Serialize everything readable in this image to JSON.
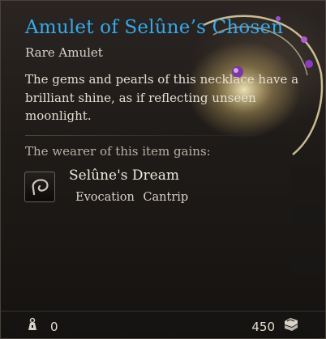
{
  "item": {
    "name": "Amulet of Selûne’s Chosen",
    "rarity_type": "Rare Amulet",
    "description": "The gems and pearls of this necklace have a brilliant shine, as if reflecting unseen moonlight.",
    "title_color": "#35a9ea"
  },
  "effects": {
    "header": "The wearer of this item gains:",
    "spell": {
      "name": "Selûne's Dream",
      "school": "Evocation",
      "level": "Cantrip",
      "icon": "moon-swirl-icon"
    }
  },
  "footer": {
    "weight": "0",
    "weight_icon": "weight-icon",
    "price": "450",
    "price_icon": "gold-icon"
  }
}
